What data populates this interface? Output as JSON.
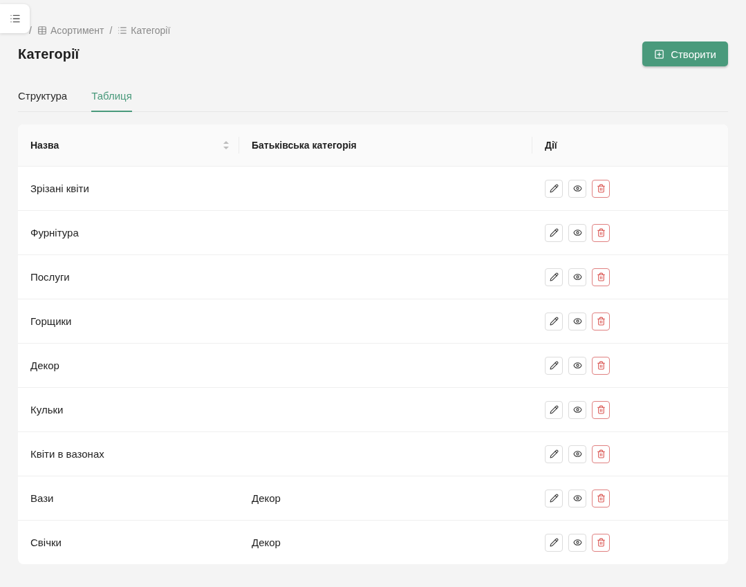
{
  "breadcrumb": [
    {
      "kind": "table",
      "separator": "/",
      "label": "Асортимент"
    },
    {
      "kind": "list",
      "separator": "/",
      "label": "Категорії"
    }
  ],
  "title": "Категорії",
  "create_button": "Створити",
  "tabs": [
    {
      "label": "Структура",
      "selected": false
    },
    {
      "label": "Таблиця",
      "selected": true
    }
  ],
  "table": {
    "columns": [
      {
        "label": "Назва",
        "sortable": true
      },
      {
        "label": "Батьківська категорія",
        "sortable": false
      },
      {
        "label": "Дії",
        "sortable": false
      }
    ],
    "rows": [
      {
        "name": "Зрізані квіти"
      },
      {
        "name": "Фурнітура"
      },
      {
        "name": "Послуги"
      },
      {
        "name": "Горщики"
      },
      {
        "name": "Декор"
      },
      {
        "name": "Кульки"
      },
      {
        "name": "Квіти в вазонах"
      },
      {
        "name": "Вази",
        "parent": "Декор"
      },
      {
        "name": "Свічки",
        "parent": "Декор"
      }
    ]
  }
}
